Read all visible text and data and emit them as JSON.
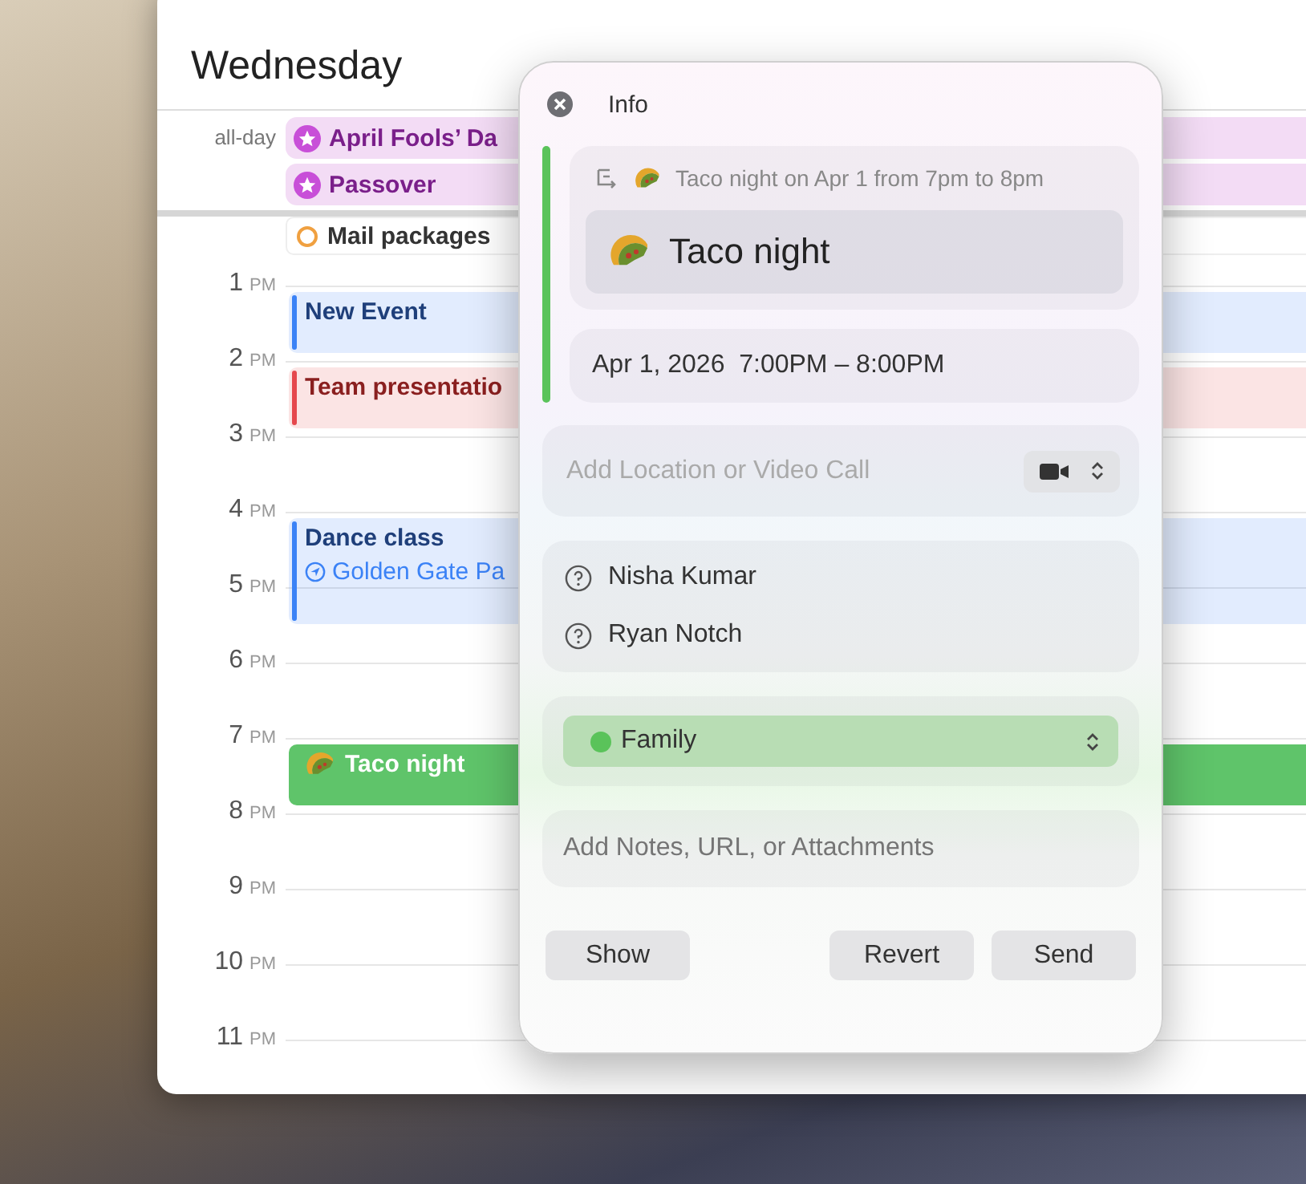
{
  "calendar": {
    "day_title": "Wednesday",
    "all_day_label": "all-day",
    "all_day_events": [
      {
        "title": "April Fools’ Da"
      },
      {
        "title": "Passover"
      }
    ],
    "tasks": [
      {
        "title": "Mail packages",
        "completed": false
      }
    ],
    "hours": [
      {
        "hour": "1",
        "period": "PM",
        "events": [
          {
            "title": "New Event",
            "color": "#3b82f6",
            "selected": false
          }
        ]
      },
      {
        "hour": "2",
        "period": "PM",
        "events": [
          {
            "title": "Team presentatio",
            "color": "#e5484d",
            "selected": false
          }
        ]
      },
      {
        "hour": "3",
        "period": "PM"
      },
      {
        "hour": "4",
        "period": "PM",
        "events": [
          {
            "title": "Dance class",
            "location": "Golden Gate Pa",
            "color": "#3b82f6",
            "selected": false
          }
        ]
      },
      {
        "hour": "5",
        "period": "PM"
      },
      {
        "hour": "6",
        "period": "PM"
      },
      {
        "hour": "7",
        "period": "PM",
        "events": [
          {
            "title": "Taco night",
            "emoji": true,
            "color": "#5fc46a",
            "selected": true
          }
        ]
      },
      {
        "hour": "8",
        "period": "PM"
      },
      {
        "hour": "9",
        "period": "PM"
      },
      {
        "hour": "10",
        "period": "PM"
      },
      {
        "hour": "11",
        "period": "PM"
      }
    ]
  },
  "popover": {
    "title": "Info",
    "suggestion": "Taco night on Apr 1 from 7pm to 8pm",
    "event_title": "Taco night",
    "date_time": "Apr 1, 2026  7:00PM – 8:00PM",
    "location": {
      "placeholder": "Add Location or Video Call"
    },
    "invitees": [
      {
        "name": "Nisha Kumar"
      },
      {
        "name": "Ryan Notch"
      }
    ],
    "calendar": {
      "name": "Family",
      "color": "#5ac35a"
    },
    "notes": {
      "placeholder": "Add Notes, URL, or Attachments"
    },
    "buttons": [
      {
        "label": "Show",
        "kind": "left"
      },
      {
        "label": "Revert",
        "kind": "right"
      },
      {
        "label": "Send",
        "kind": "right"
      }
    ]
  }
}
